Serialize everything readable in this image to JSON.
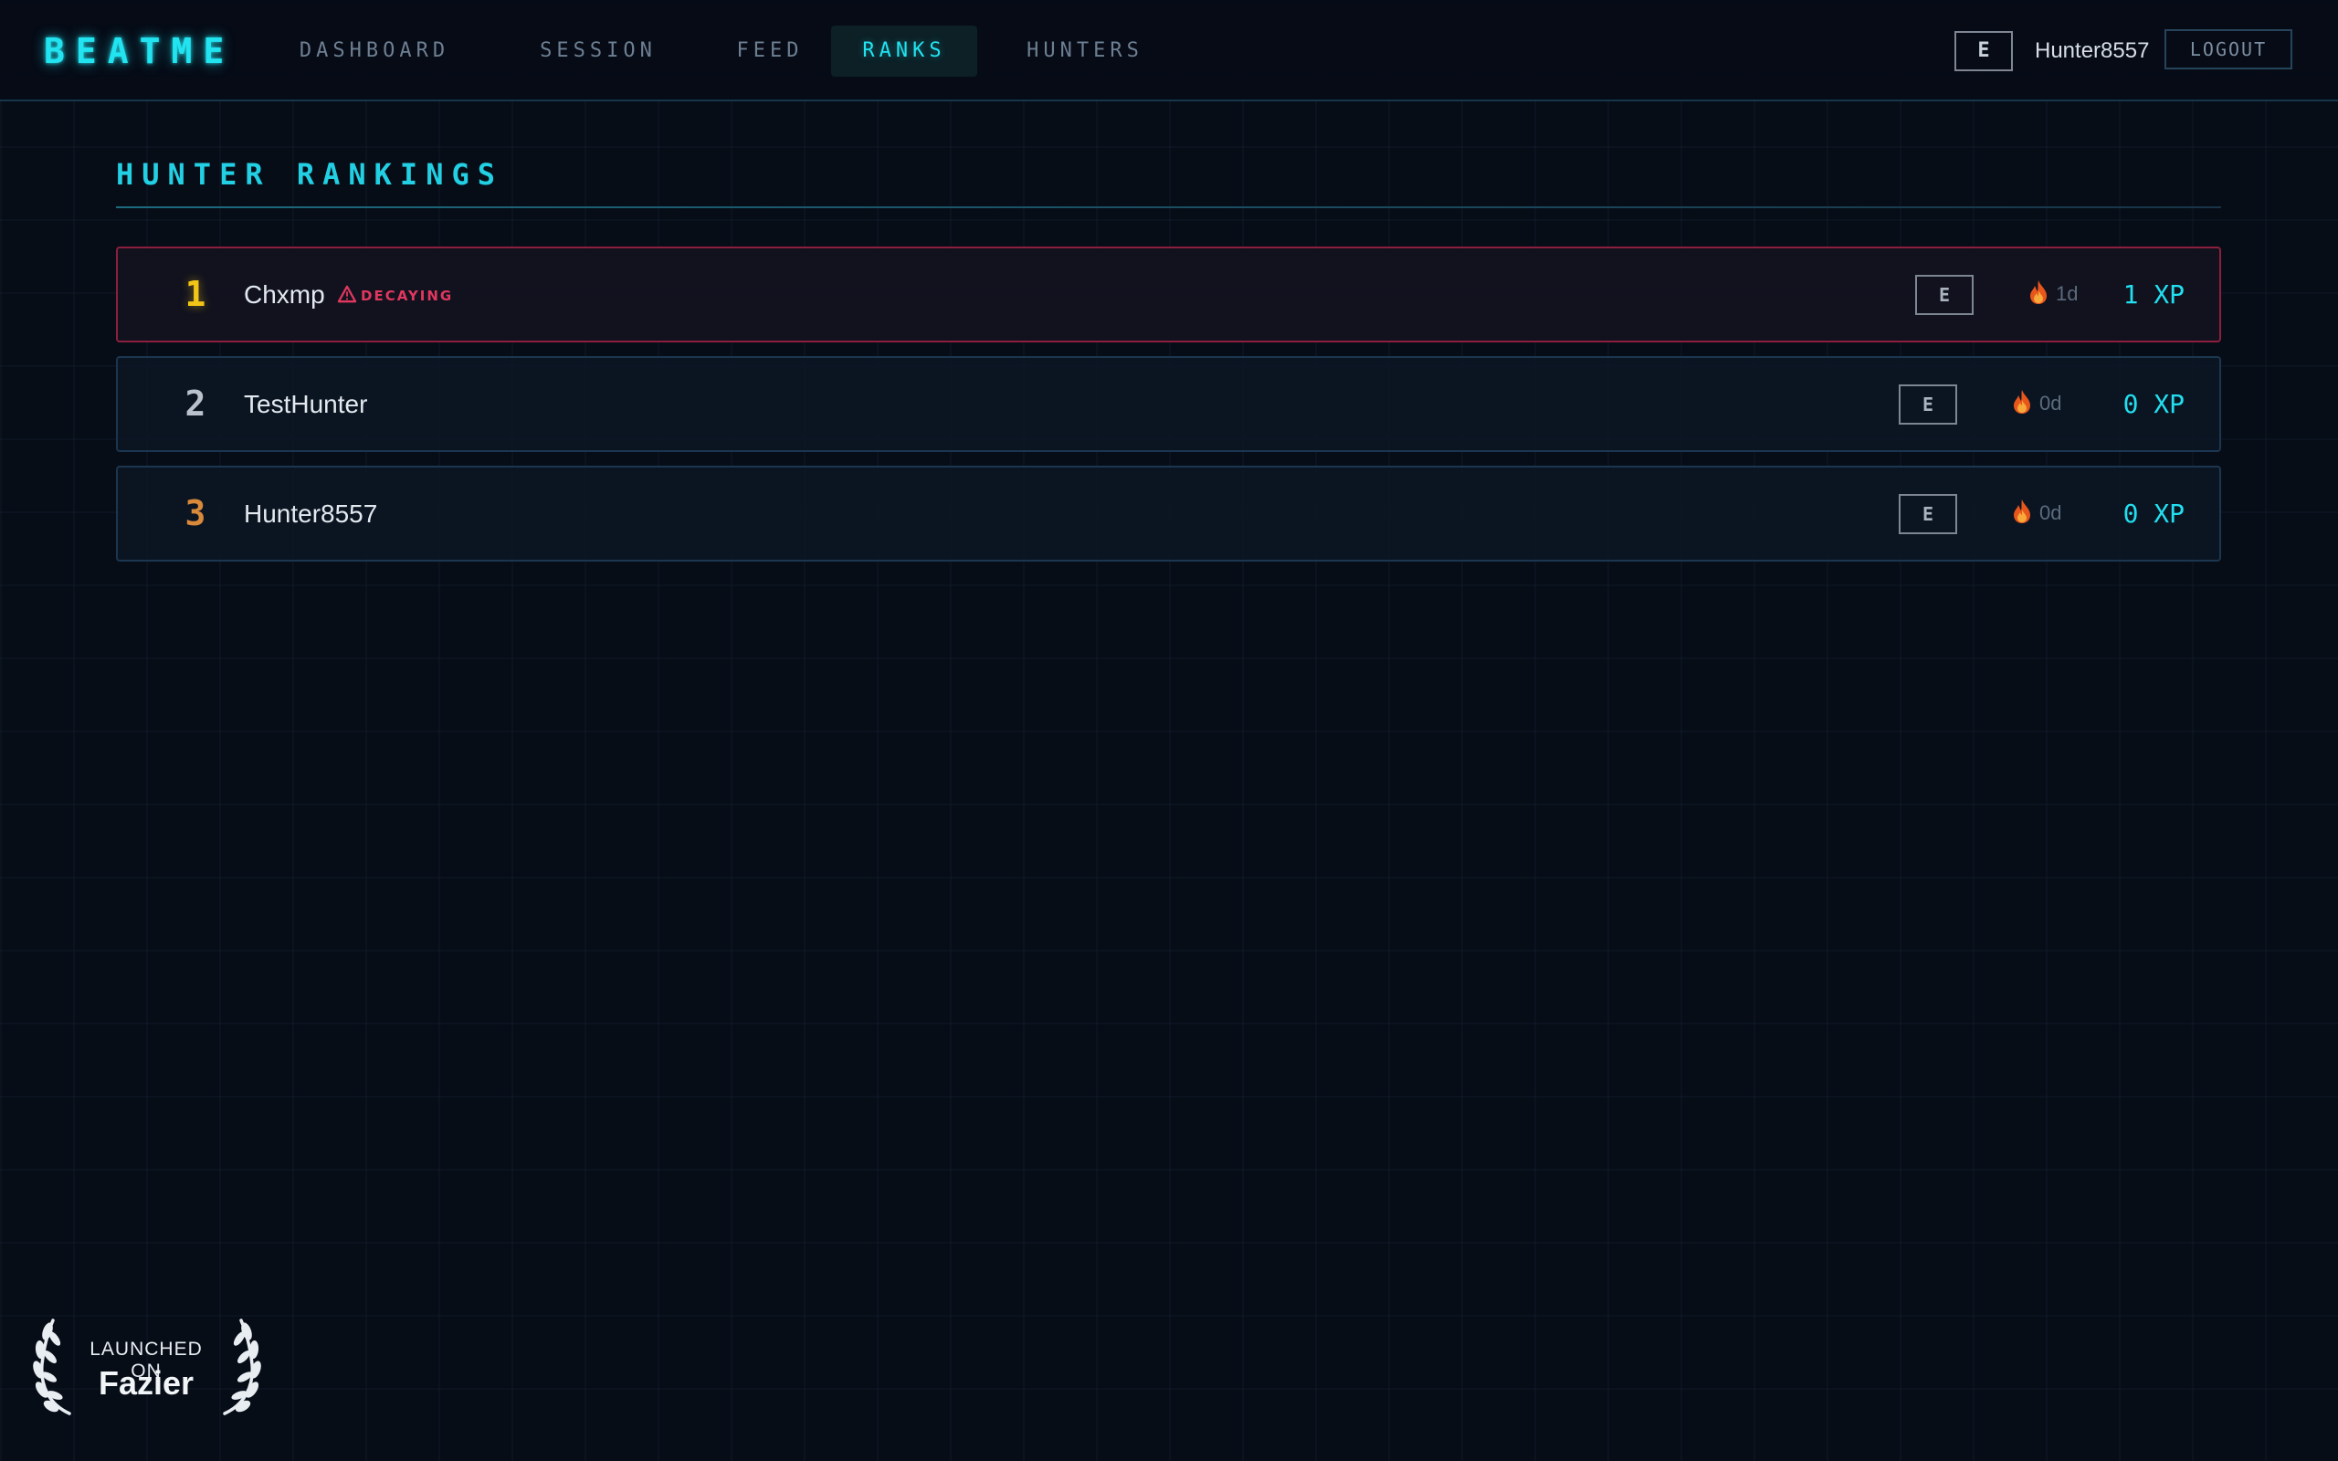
{
  "app": {
    "logo": "BEATME"
  },
  "nav": {
    "items": [
      {
        "label": "DASHBOARD",
        "active": false
      },
      {
        "label": "SESSION",
        "active": false
      },
      {
        "label": "FEED",
        "active": false
      },
      {
        "label": "RANKS",
        "active": true
      },
      {
        "label": "HUNTERS",
        "active": false
      }
    ]
  },
  "user": {
    "rank": "E",
    "name": "Hunter8557",
    "logout_label": "LOGOUT"
  },
  "page": {
    "title": "HUNTER RANKINGS"
  },
  "rankings": [
    {
      "position": "1",
      "position_color": "#f2c417",
      "name": "Chxmp",
      "decay_label": "DECAYING",
      "rank": "E",
      "streak_icon": "flame-icon",
      "streak": "1d",
      "xp": "1 XP",
      "decaying": true
    },
    {
      "position": "2",
      "position_color": "#b9c2cc",
      "name": "TestHunter",
      "rank": "E",
      "streak_icon": "flame-icon",
      "streak": "0d",
      "xp": "0 XP",
      "decaying": false
    },
    {
      "position": "3",
      "position_color": "#d9893a",
      "name": "Hunter8557",
      "rank": "E",
      "streak_icon": "flame-icon",
      "streak": "0d",
      "xp": "0 XP",
      "decaying": false
    }
  ],
  "badge": {
    "kicker": "LAUNCHED ON",
    "brand": "Fazier",
    "icon": "laurel-icon"
  },
  "colors": {
    "accent": "#22e3f0",
    "background": "#070d17",
    "decay": "#e0375f",
    "gold": "#f2c417",
    "silver": "#b9c2cc",
    "bronze": "#d9893a"
  }
}
